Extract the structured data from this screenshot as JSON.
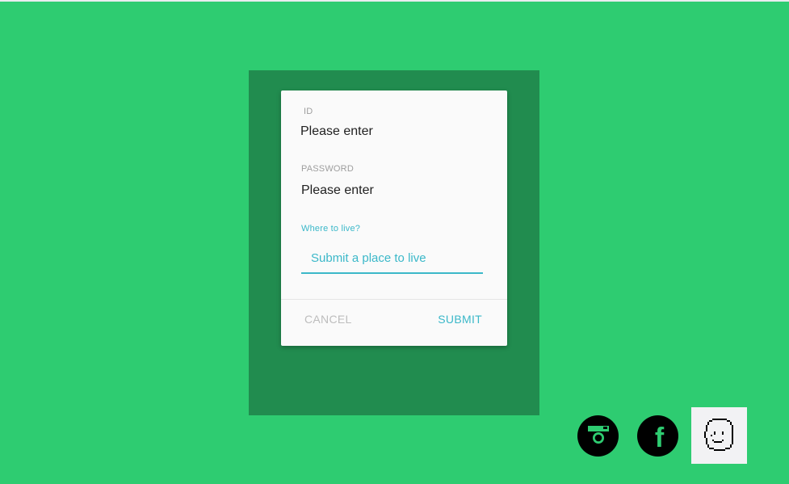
{
  "form": {
    "id_label": "ID",
    "id_value": "Please enter",
    "password_label": "PASSWORD",
    "password_value": "Please enter",
    "live_label": "Where to live?",
    "live_placeholder": "Submit a place to live",
    "cancel_label": "CANCEL",
    "submit_label": "SUBMIT"
  },
  "social": {
    "items": [
      {
        "icon": "instagram-icon"
      },
      {
        "icon": "facebook-icon",
        "glyph": "f"
      },
      {
        "icon": "pixel-face-icon"
      }
    ]
  },
  "colors": {
    "background": "#2ecc71",
    "panel": "#218c4f",
    "card": "#fafafa",
    "accent": "#3bb8c9",
    "muted": "#bdbdbd"
  }
}
